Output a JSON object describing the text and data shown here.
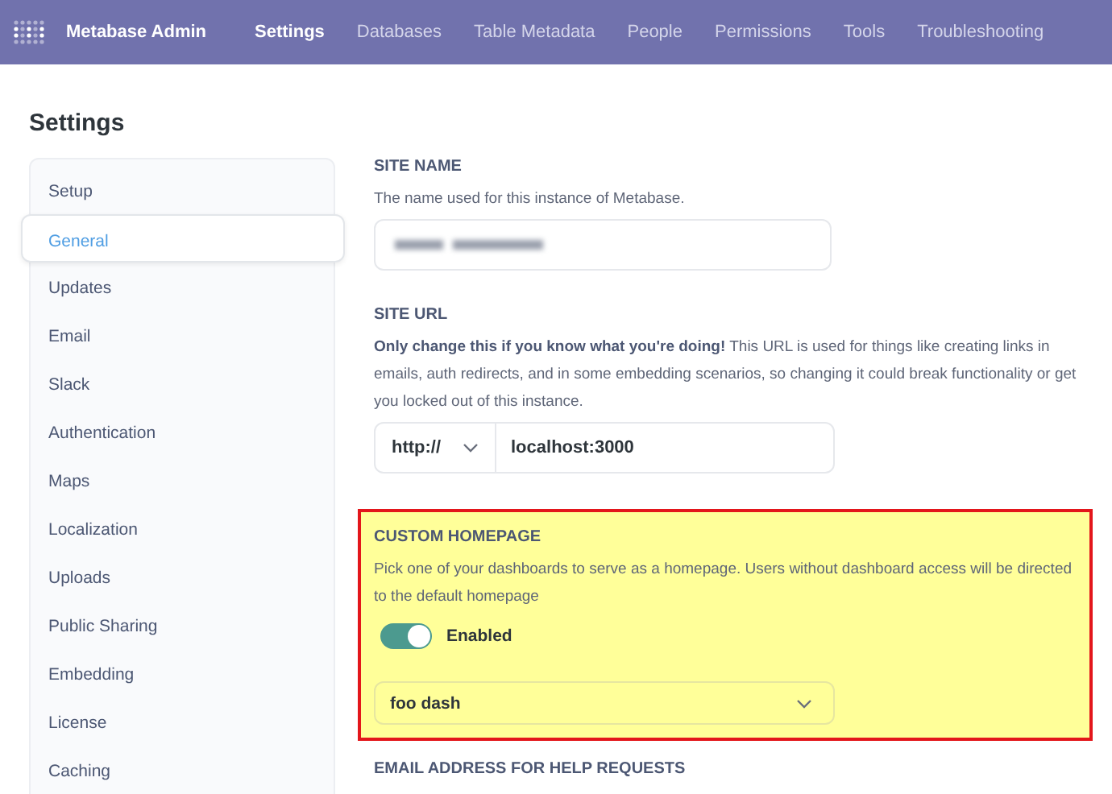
{
  "header": {
    "brand": "Metabase Admin",
    "nav": [
      {
        "label": "Settings",
        "selected": true
      },
      {
        "label": "Databases",
        "selected": false
      },
      {
        "label": "Table Metadata",
        "selected": false
      },
      {
        "label": "People",
        "selected": false
      },
      {
        "label": "Permissions",
        "selected": false
      },
      {
        "label": "Tools",
        "selected": false
      },
      {
        "label": "Troubleshooting",
        "selected": false
      }
    ]
  },
  "page_title": "Settings",
  "sidebar": {
    "items": [
      {
        "label": "Setup",
        "selected": false
      },
      {
        "label": "General",
        "selected": true
      },
      {
        "label": "Updates",
        "selected": false
      },
      {
        "label": "Email",
        "selected": false
      },
      {
        "label": "Slack",
        "selected": false
      },
      {
        "label": "Authentication",
        "selected": false
      },
      {
        "label": "Maps",
        "selected": false
      },
      {
        "label": "Localization",
        "selected": false
      },
      {
        "label": "Uploads",
        "selected": false
      },
      {
        "label": "Public Sharing",
        "selected": false
      },
      {
        "label": "Embedding",
        "selected": false
      },
      {
        "label": "License",
        "selected": false
      },
      {
        "label": "Caching",
        "selected": false
      }
    ]
  },
  "sections": [
    {
      "kind": "blurred-input",
      "title": "SITE NAME",
      "description": "The name used for this instance of Metabase.",
      "highlighted": false
    },
    {
      "kind": "url",
      "title": "SITE URL",
      "description": "**Only change this if you know what you're doing!** This URL is used for things like creating links in emails, auth redirects, and in some embedding scenarios, so changing it could break functionality or get you locked out of this instance.",
      "protocol": "http://",
      "value": "localhost:3000",
      "highlighted": false
    },
    {
      "kind": "homepage",
      "title": "CUSTOM HOMEPAGE",
      "description": "Pick one of your dashboards to serve as a homepage. Users without dashboard access will be directed to the default homepage",
      "toggle": {
        "label": "Enabled",
        "on": true
      },
      "dashboard": "foo dash",
      "highlighted": true
    },
    {
      "kind": "heading",
      "title": "EMAIL ADDRESS FOR HELP REQUESTS",
      "highlighted": false
    }
  ]
}
